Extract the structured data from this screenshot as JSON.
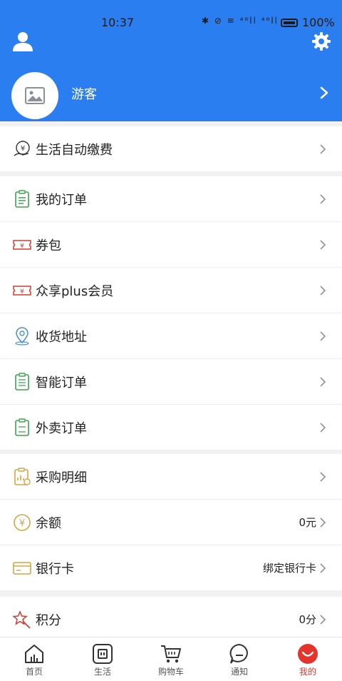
{
  "status_bar": {
    "time": "10:37",
    "icons": "✱ ⊘ ≋ ⁴⁶ll ⁴⁶ll",
    "battery": "100%"
  },
  "header": {
    "guest_name": "游客"
  },
  "section1": [
    {
      "label": "生活自动缴费",
      "icon": "auto-pay-icon"
    }
  ],
  "section2": [
    {
      "label": "我的订单",
      "icon": "order-icon"
    },
    {
      "label": "券包",
      "icon": "coupon-icon"
    },
    {
      "label": "众享plus会员",
      "icon": "plus-member-icon"
    },
    {
      "label": "收货地址",
      "icon": "location-icon"
    },
    {
      "label": "智能订单",
      "icon": "smart-order-icon"
    },
    {
      "label": "外卖订单",
      "icon": "takeout-order-icon"
    }
  ],
  "section3": [
    {
      "label": "采购明细",
      "icon": "purchase-detail-icon",
      "value": ""
    },
    {
      "label": "余额",
      "icon": "balance-icon",
      "value": "0元"
    },
    {
      "label": "银行卡",
      "icon": "bank-card-icon",
      "value": "绑定银行卡"
    }
  ],
  "section4": [
    {
      "label": "积分",
      "icon": "points-icon",
      "value": "0分"
    }
  ],
  "tabs": [
    {
      "label": "首页",
      "icon": "home-icon"
    },
    {
      "label": "生活",
      "icon": "life-icon"
    },
    {
      "label": "购物车",
      "icon": "cart-icon"
    },
    {
      "label": "通知",
      "icon": "notification-icon"
    },
    {
      "label": "我的",
      "icon": "mine-icon"
    }
  ],
  "colors": {
    "brand": "#2a7ef0",
    "active_tab": "#e4352c"
  }
}
